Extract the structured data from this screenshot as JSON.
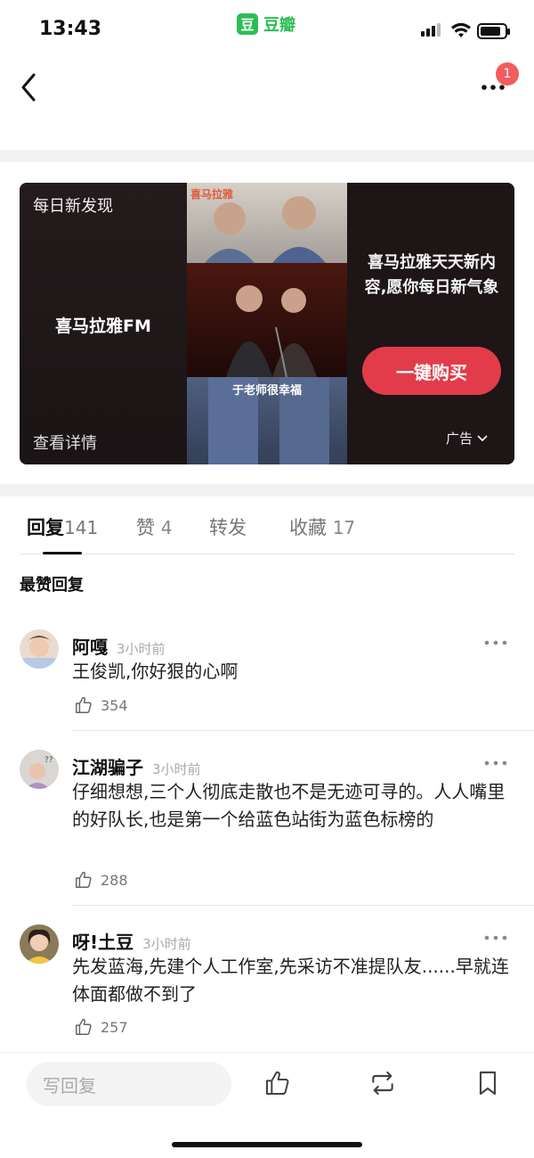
{
  "status_bar": {
    "time": "13:43",
    "app_name": "豆瓣",
    "app_logo_char": "豆"
  },
  "nav": {
    "notification_count": "1"
  },
  "ad": {
    "tag": "每日新发现",
    "brand": "喜马拉雅FM",
    "detail_link": "查看详情",
    "image_logo": "喜马拉雅",
    "image_caption": "于老师很幸福",
    "slogan": "喜马拉雅天天新内容,愿你每日新气象",
    "buy_button": "一键购买",
    "ad_label": "广告"
  },
  "tabs": [
    {
      "label": "回复",
      "count": "141",
      "active": true
    },
    {
      "label": "赞",
      "count": "4"
    },
    {
      "label": "转发",
      "count": ""
    },
    {
      "label": "收藏",
      "count": "17"
    }
  ],
  "section_title": "最赞回复",
  "comments": [
    {
      "name": "阿嘎",
      "time": "3小时前",
      "text": "王俊凯,你好狠的心啊",
      "likes": "354"
    },
    {
      "name": "江湖骗子",
      "time": "3小时前",
      "text": "仔细想想,三个人彻底走散也不是无迹可寻的。人人嘴里的好队长,也是第一个给蓝色站街为蓝色标榜的",
      "likes": "288"
    },
    {
      "name": "呀!土豆",
      "time": "3小时前",
      "text": "先发蓝海,先建个人工作室,先采访不准提队友......早就连体面都做不到了",
      "likes": "257"
    }
  ],
  "bottom_bar": {
    "reply_placeholder": "写回复"
  },
  "colors": {
    "accent_green": "#2dbd57",
    "buy_red": "#e23c4b",
    "badge_red": "#f25c5c"
  }
}
